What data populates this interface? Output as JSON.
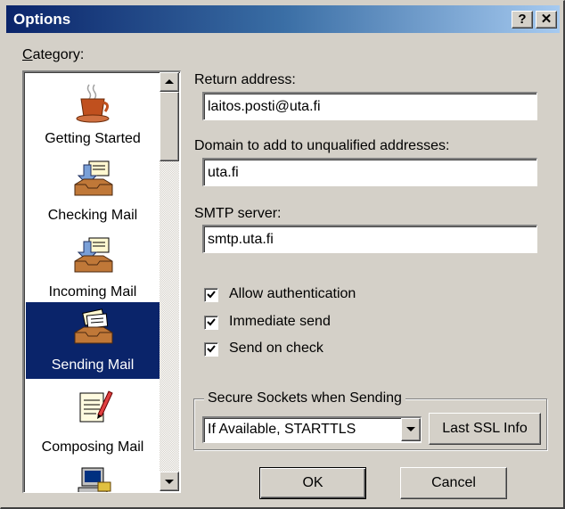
{
  "window": {
    "title": "Options",
    "help_glyph": "?",
    "close_glyph": "✕"
  },
  "category": {
    "label": "Category:",
    "items": [
      {
        "label": "Getting Started",
        "icon": "coffee-cup-icon"
      },
      {
        "label": "Checking Mail",
        "icon": "inbox-tray-icon"
      },
      {
        "label": "Incoming Mail",
        "icon": "inbox-tray-icon"
      },
      {
        "label": "Sending Mail",
        "icon": "outbox-tray-icon",
        "selected": true
      },
      {
        "label": "Composing Mail",
        "icon": "notepad-pen-icon"
      },
      {
        "label": "",
        "icon": "computer-icon"
      }
    ]
  },
  "form": {
    "return_address_label": "Return address:",
    "return_address_value": "laitos.posti@uta.fi",
    "domain_label": "Domain to add to unqualified addresses:",
    "domain_value": "uta.fi",
    "smtp_label": "SMTP server:",
    "smtp_value": "smtp.uta.fi",
    "allow_auth_label": "Allow authentication",
    "allow_auth_checked": true,
    "immediate_send_label": "Immediate send",
    "immediate_send_checked": true,
    "send_on_check_label": "Send on check",
    "send_on_check_checked": true
  },
  "ssl": {
    "group_label": "Secure Sockets when Sending",
    "selected_option": "If Available, STARTTLS",
    "last_info_button": "Last SSL Info"
  },
  "buttons": {
    "ok": "OK",
    "cancel": "Cancel"
  }
}
